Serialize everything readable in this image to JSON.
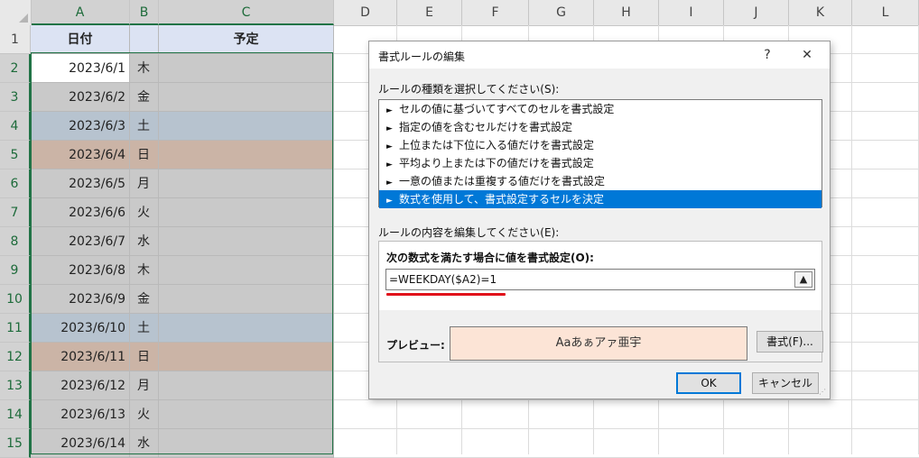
{
  "columns": [
    "A",
    "B",
    "C",
    "D",
    "E",
    "F",
    "G",
    "H",
    "I",
    "J",
    "K",
    "L"
  ],
  "headers": {
    "date": "日付",
    "weekday": "",
    "plan": "予定"
  },
  "rows": [
    {
      "row": "1",
      "date": "",
      "day": ""
    },
    {
      "row": "2",
      "date": "2023/6/1",
      "day": "木"
    },
    {
      "row": "3",
      "date": "2023/6/2",
      "day": "金"
    },
    {
      "row": "4",
      "date": "2023/6/3",
      "day": "土"
    },
    {
      "row": "5",
      "date": "2023/6/4",
      "day": "日"
    },
    {
      "row": "6",
      "date": "2023/6/5",
      "day": "月"
    },
    {
      "row": "7",
      "date": "2023/6/6",
      "day": "火"
    },
    {
      "row": "8",
      "date": "2023/6/7",
      "day": "水"
    },
    {
      "row": "9",
      "date": "2023/6/8",
      "day": "木"
    },
    {
      "row": "10",
      "date": "2023/6/9",
      "day": "金"
    },
    {
      "row": "11",
      "date": "2023/6/10",
      "day": "土"
    },
    {
      "row": "12",
      "date": "2023/6/11",
      "day": "日"
    },
    {
      "row": "13",
      "date": "2023/6/12",
      "day": "月"
    },
    {
      "row": "14",
      "date": "2023/6/13",
      "day": "火"
    },
    {
      "row": "15",
      "date": "2023/6/14",
      "day": "水"
    }
  ],
  "colors": {
    "selection_fill": "#c9c9c9",
    "saturday_fill": "#b7c3cf",
    "sunday_fill": "#cbb4a6",
    "header_fill": "#dce3f3",
    "excel_green": "#217346",
    "list_highlight": "#0078d7",
    "preview_fill": "#fce4d6",
    "underline_red": "#e0101a"
  },
  "dialog": {
    "title": "書式ルールの編集",
    "help_label": "?",
    "close_icon": "close-icon",
    "rule_type_label": "ルールの種類を選択してください(S):",
    "rule_types": [
      "セルの値に基づいてすべてのセルを書式設定",
      "指定の値を含むセルだけを書式設定",
      "上位または下位に入る値だけを書式設定",
      "平均より上または下の値だけを書式設定",
      "一意の値または重複する値だけを書式設定",
      "数式を使用して、書式設定するセルを決定"
    ],
    "selected_rule_index": 5,
    "edit_label": "ルールの内容を編集してください(E):",
    "formula_label": "次の数式を満たす場合に値を書式設定(O):",
    "formula_value": "=WEEKDAY($A2)=1",
    "preview_label": "プレビュー:",
    "preview_text": "Aaあぁアァ亜宇",
    "format_button": "書式(F)...",
    "ok_button": "OK",
    "cancel_button": "キャンセル"
  }
}
